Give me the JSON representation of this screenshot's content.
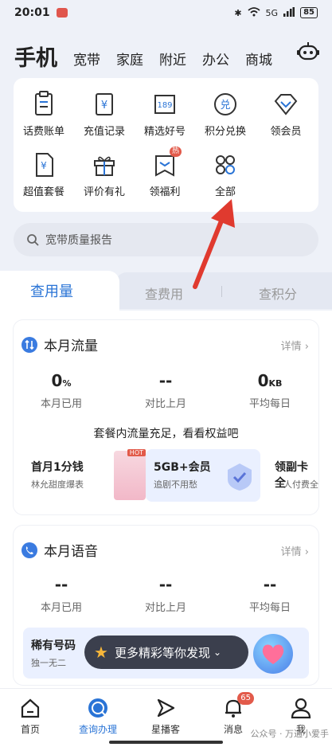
{
  "status": {
    "time": "20:01",
    "battery": "85",
    "signal": "5G"
  },
  "topnav": {
    "active": "手机",
    "tabs": [
      "宽带",
      "家庭",
      "附近",
      "办公",
      "商城"
    ]
  },
  "quick": [
    {
      "label": "话费账单",
      "icon": "bill-icon"
    },
    {
      "label": "充值记录",
      "icon": "recharge-record-icon"
    },
    {
      "label": "精选好号",
      "icon": "number-189-icon"
    },
    {
      "label": "积分兑换",
      "icon": "points-exchange-icon"
    },
    {
      "label": "领会员",
      "icon": "membership-icon"
    },
    {
      "label": "超值套餐",
      "icon": "package-icon"
    },
    {
      "label": "评价有礼",
      "icon": "gift-icon"
    },
    {
      "label": "领福利",
      "icon": "welfare-icon",
      "badge": "热"
    },
    {
      "label": "全部",
      "icon": "all-grid-icon"
    }
  ],
  "search": {
    "placeholder": "宽带质量报告"
  },
  "query_tabs": {
    "usage": "查用量",
    "fees": "查费用",
    "points": "查积分"
  },
  "traffic": {
    "title": "本月流量",
    "detail": "详情",
    "used": "0",
    "used_unit": "%",
    "used_label": "本月已用",
    "compare": "--",
    "compare_label": "对比上月",
    "avg": "0",
    "avg_unit": "KB",
    "avg_label": "平均每日",
    "notice": "套餐内流量充足，看看权益吧",
    "promos": [
      {
        "title": "首月1分钱",
        "sub": "林允甜度爆表",
        "badge": "HOT"
      },
      {
        "title": "5GB+会员",
        "sub": "追剧不用愁"
      },
      {
        "title": "领副卡全",
        "sub": "一人付费全"
      }
    ]
  },
  "voice": {
    "title": "本月语音",
    "detail": "详情",
    "used": "--",
    "used_label": "本月已用",
    "compare": "--",
    "compare_label": "对比上月",
    "avg": "--",
    "avg_label": "平均每日",
    "promo_title": "稀有号码",
    "promo_sub": "独一无二"
  },
  "toast": {
    "text": "更多精彩等你发现"
  },
  "bottomnav": {
    "items": [
      {
        "label": "首页"
      },
      {
        "label": "查询办理"
      },
      {
        "label": "星播客"
      },
      {
        "label": "消息",
        "badge": "65"
      },
      {
        "label": "我"
      }
    ]
  },
  "watermark": "公众号 · 万通小爱手",
  "colors": {
    "accent": "#2a74d6",
    "badge": "#e25a4a",
    "arrow": "#e03a2f"
  }
}
